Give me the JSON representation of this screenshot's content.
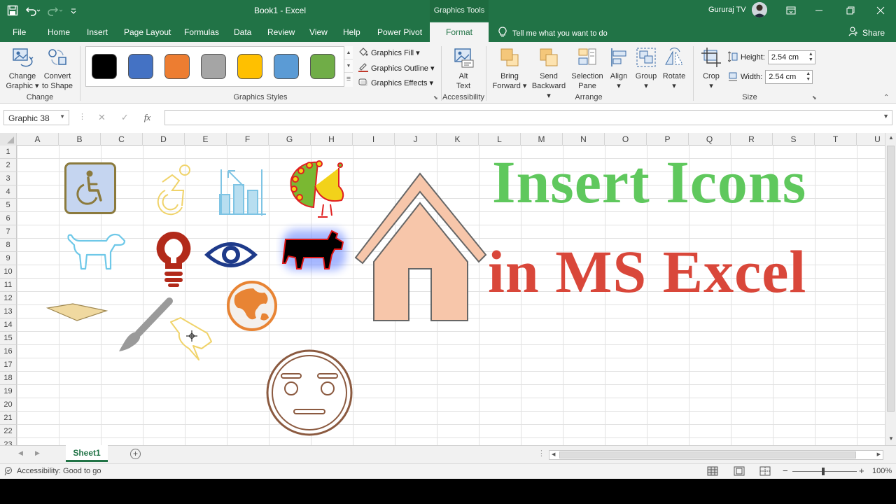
{
  "window": {
    "title": "Book1  -  Excel",
    "contextual_tools": "Graphics Tools",
    "user": "Gururaj TV"
  },
  "tabs": [
    "File",
    "Home",
    "Insert",
    "Page Layout",
    "Formulas",
    "Data",
    "Review",
    "View",
    "Help",
    "Power Pivot"
  ],
  "active_tab": "Format",
  "tell_me": "Tell me what you want to do",
  "share": "Share",
  "ribbon": {
    "change": {
      "change_graphic": [
        "Change",
        "Graphic ▾"
      ],
      "convert_to_shape": [
        "Convert",
        "to Shape"
      ],
      "label": "Change"
    },
    "graphics_styles": {
      "swatches": [
        "#000000",
        "#4472c4",
        "#ed7d31",
        "#a5a5a5",
        "#ffc000",
        "#5b9bd5",
        "#70ad47"
      ],
      "fill": "Graphics Fill ▾",
      "outline": "Graphics Outline ▾",
      "effects": "Graphics Effects ▾",
      "label": "Graphics Styles"
    },
    "accessibility": {
      "alt_text": [
        "Alt",
        "Text"
      ],
      "label": "Accessibility"
    },
    "arrange": {
      "bring_forward": [
        "Bring",
        "Forward ▾"
      ],
      "send_backward": [
        "Send",
        "Backward ▾"
      ],
      "selection_pane": [
        "Selection",
        "Pane"
      ],
      "align": [
        "Align",
        "▾"
      ],
      "group": [
        "Group",
        "▾"
      ],
      "rotate": [
        "Rotate",
        "▾"
      ],
      "label": "Arrange"
    },
    "size": {
      "crop": [
        "Crop",
        "▾"
      ],
      "height_label": "Height:",
      "height_value": "2.54 cm",
      "width_label": "Width:",
      "width_value": "2.54 cm",
      "label": "Size"
    }
  },
  "formula_bar": {
    "name_box": "Graphic 38",
    "fx": "fx",
    "value": ""
  },
  "columns": [
    "A",
    "B",
    "C",
    "D",
    "E",
    "F",
    "G",
    "H",
    "I",
    "J",
    "K",
    "L",
    "M",
    "N",
    "O",
    "P",
    "Q",
    "R",
    "S",
    "T",
    "U"
  ],
  "rows": [
    "1",
    "2",
    "3",
    "4",
    "5",
    "6",
    "7",
    "8",
    "9",
    "10",
    "11",
    "12",
    "13",
    "14",
    "15",
    "16",
    "17",
    "18",
    "19",
    "20",
    "21",
    "22",
    "23"
  ],
  "banner": {
    "line1": "Insert Icons",
    "line2": "in MS Excel",
    "color1": "#5fc85d",
    "color2": "#d9473a"
  },
  "icons": [
    "wheelchair-icon",
    "accessible-icon",
    "growth-chart-icon",
    "peacock-icon",
    "house-icon",
    "dog-icon",
    "lightbulb-icon",
    "eye-icon",
    "cow-icon",
    "globe-icon",
    "map-icon",
    "paintbrush-icon",
    "pushpin-icon",
    "neutral-face-icon"
  ],
  "sheet_tab": "Sheet1",
  "status": {
    "text": "Accessibility: Good to go",
    "zoom": "100%"
  }
}
